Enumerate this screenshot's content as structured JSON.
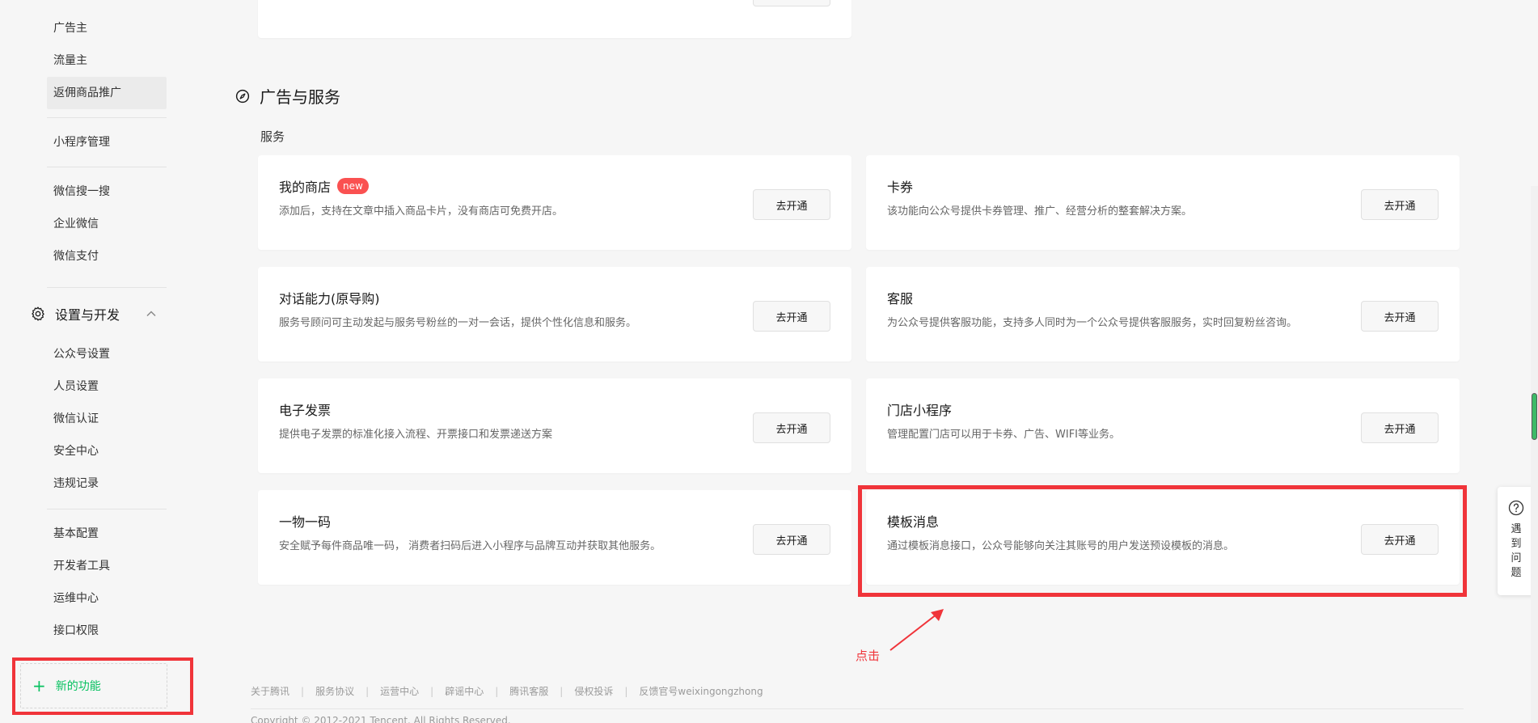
{
  "sidebar": {
    "items_top": [
      "广告主",
      "流量主",
      "返佣商品推广"
    ],
    "items_group2": [
      "小程序管理"
    ],
    "items_group3": [
      "微信搜一搜",
      "企业微信",
      "微信支付"
    ],
    "section": {
      "label": "设置与开发",
      "icon": "gear-icon"
    },
    "items_settings": [
      "公众号设置",
      "人员设置",
      "微信认证",
      "安全中心",
      "违规记录"
    ],
    "items_dev": [
      "基本配置",
      "开发者工具",
      "运维中心",
      "接口权限"
    ],
    "new_function": "新的功能"
  },
  "main": {
    "section_title": "广告与服务",
    "sub_title": "服务",
    "button_label": "去开通",
    "badge_new": "new",
    "cards": [
      {
        "title": "我的商店",
        "desc": "添加后，支持在文章中插入商品卡片，没有商店可免费开店。"
      },
      {
        "title": "卡券",
        "desc": "该功能向公众号提供卡券管理、推广、经营分析的整套解决方案。"
      },
      {
        "title": "对话能力(原导购)",
        "desc": "服务号顾问可主动发起与服务号粉丝的一对一会话，提供个性化信息和服务。"
      },
      {
        "title": "客服",
        "desc": "为公众号提供客服功能，支持多人同时为一个公众号提供客服服务，实时回复粉丝咨询。"
      },
      {
        "title": "电子发票",
        "desc": "提供电子发票的标准化接入流程、开票接口和发票递送方案"
      },
      {
        "title": "门店小程序",
        "desc": "管理配置门店可以用于卡券、广告、WIFI等业务。"
      },
      {
        "title": "一物一码",
        "desc": "安全赋予每件商品唯一码， 消费者扫码后进入小程序与品牌互动并获取其他服务。"
      },
      {
        "title": "模板消息",
        "desc": "通过模板消息接口，公众号能够向关注其账号的用户发送预设模板的消息。"
      }
    ],
    "annotation_label": "点击"
  },
  "footer": {
    "links": [
      "关于腾讯",
      "服务协议",
      "运营中心",
      "辟谣中心",
      "腾讯客服",
      "侵权投诉",
      "反馈官号weixingongzhong"
    ],
    "copyright": "Copyright © 2012-2021 Tencent. All Rights Reserved."
  },
  "help": {
    "label": "遇到问题"
  },
  "colors": {
    "accent_green": "#07c160",
    "annotation_red": "#f0343a",
    "badge_red": "#fa5151"
  }
}
